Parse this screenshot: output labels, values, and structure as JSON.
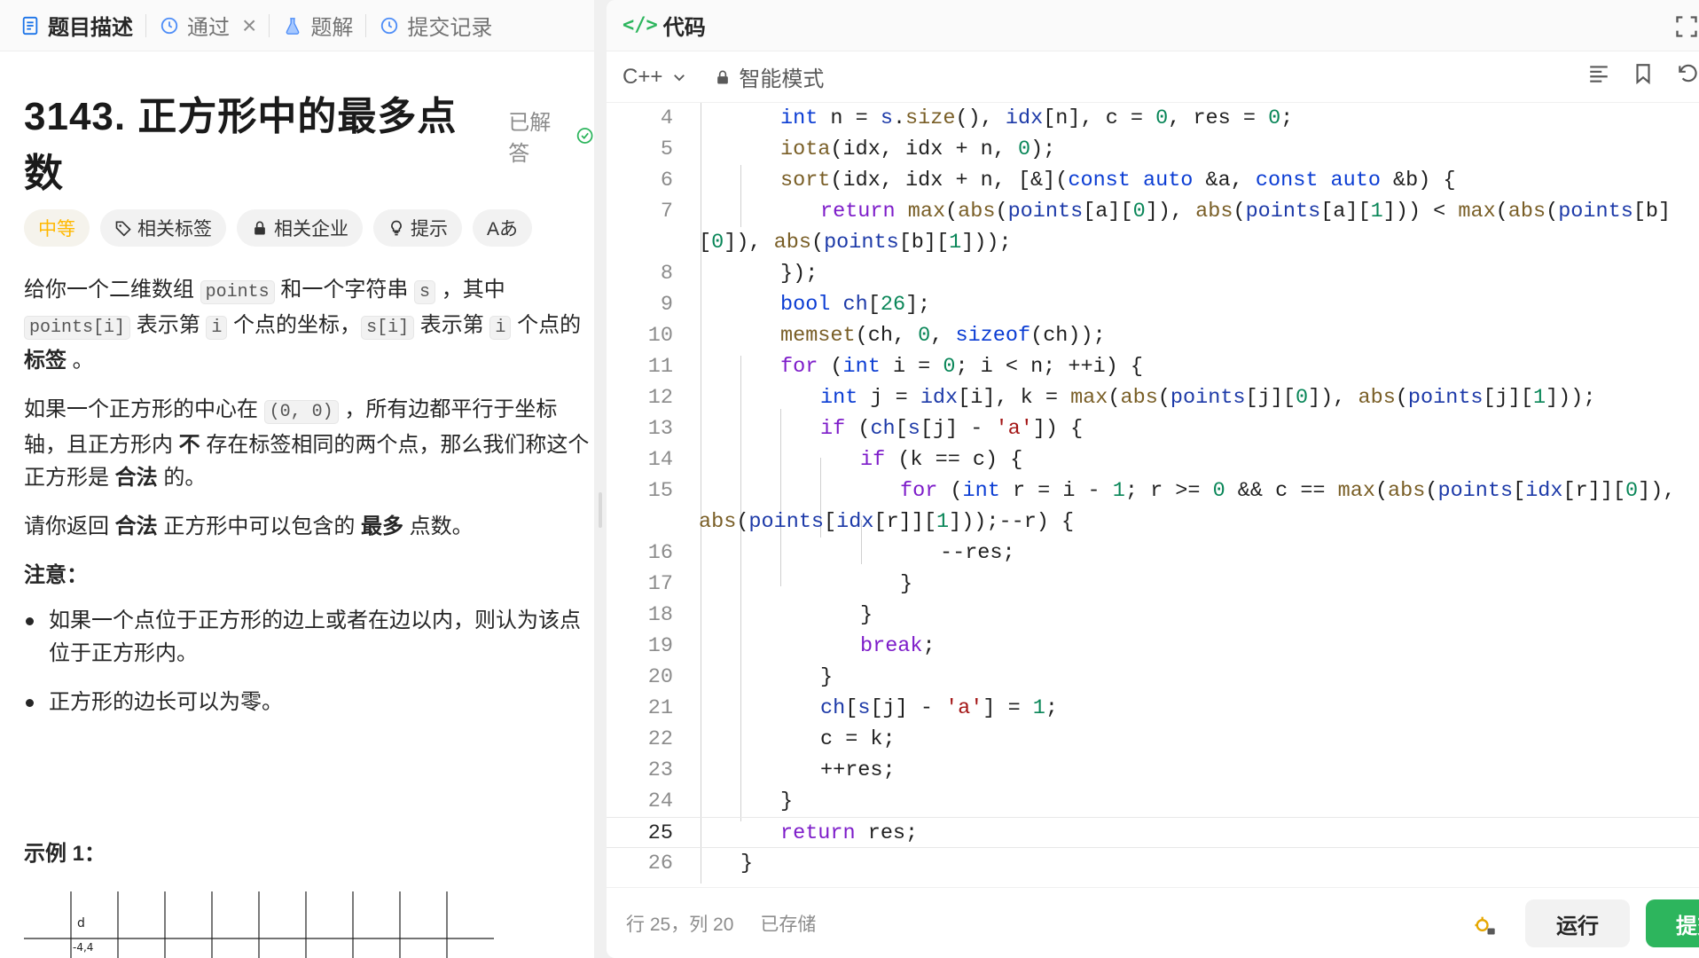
{
  "tabs": [
    {
      "label": "题目描述",
      "icon": "description-icon"
    },
    {
      "label": "通过",
      "icon": "history-icon"
    },
    {
      "label": "题解",
      "icon": "flask-icon"
    },
    {
      "label": "提交记录",
      "icon": "history-icon"
    }
  ],
  "problem": {
    "title": "3143. 正方形中的最多点数",
    "status": "已解答",
    "difficulty": "中等",
    "tag_buttons": [
      "相关标签",
      "相关企业",
      "提示"
    ],
    "font_button": "Aあ",
    "desc": {
      "p1_a": "给你一个二维数组 ",
      "p1_code1": "points",
      "p1_b": " 和一个字符串 ",
      "p1_code2": "s",
      "p1_c": " ，其中 ",
      "p1_code3": "points[i]",
      "p1_d": " 表示第 ",
      "p1_code4": "i",
      "p1_e": " 个点的坐标，",
      "p1_code5": "s[i]",
      "p1_f": " 表示第 ",
      "p1_code6": "i",
      "p1_g": " 个点的 ",
      "p1_bold": "标签",
      "p1_h": " 。",
      "p2_a": "如果一个正方形的中心在 ",
      "p2_code": "(0, 0)",
      "p2_b": " ，所有边都平行于坐标轴，且正方形内 ",
      "p2_bold1": "不",
      "p2_c": " 存在标签相同的两个点，那么我们称这个正方形是 ",
      "p2_bold2": "合法",
      "p2_d": " 的。",
      "p3_a": "请你返回 ",
      "p3_bold1": "合法",
      "p3_b": " 正方形中可以包含的 ",
      "p3_bold2": "最多",
      "p3_c": " 点数。",
      "note": "注意：",
      "bullets": [
        "如果一个点位于正方形的边上或者在边以内，则认为该点位于正方形内。",
        "正方形的边长可以为零。"
      ]
    },
    "example_head": "示例 1：",
    "grid_label": "d",
    "grid_coord": "-4,4"
  },
  "editor": {
    "header": "代码",
    "language": "C++",
    "mode": "智能模式",
    "status_pos": "行 25，列 20",
    "status_saved": "已存储",
    "run_label": "运行",
    "submit_label": "提交"
  },
  "code_lines": [
    {
      "n": "4"
    },
    {
      "n": "5"
    },
    {
      "n": "6"
    },
    {
      "n": "7"
    },
    {
      "n": ""
    },
    {
      "n": "8"
    },
    {
      "n": "9"
    },
    {
      "n": "10"
    },
    {
      "n": "11"
    },
    {
      "n": "12"
    },
    {
      "n": "13"
    },
    {
      "n": "14"
    },
    {
      "n": "15"
    },
    {
      "n": ""
    },
    {
      "n": "16"
    },
    {
      "n": "17"
    },
    {
      "n": "18"
    },
    {
      "n": "19"
    },
    {
      "n": "20"
    },
    {
      "n": "21"
    },
    {
      "n": "22"
    },
    {
      "n": "23"
    },
    {
      "n": "24"
    },
    {
      "n": "25"
    },
    {
      "n": "26"
    }
  ]
}
